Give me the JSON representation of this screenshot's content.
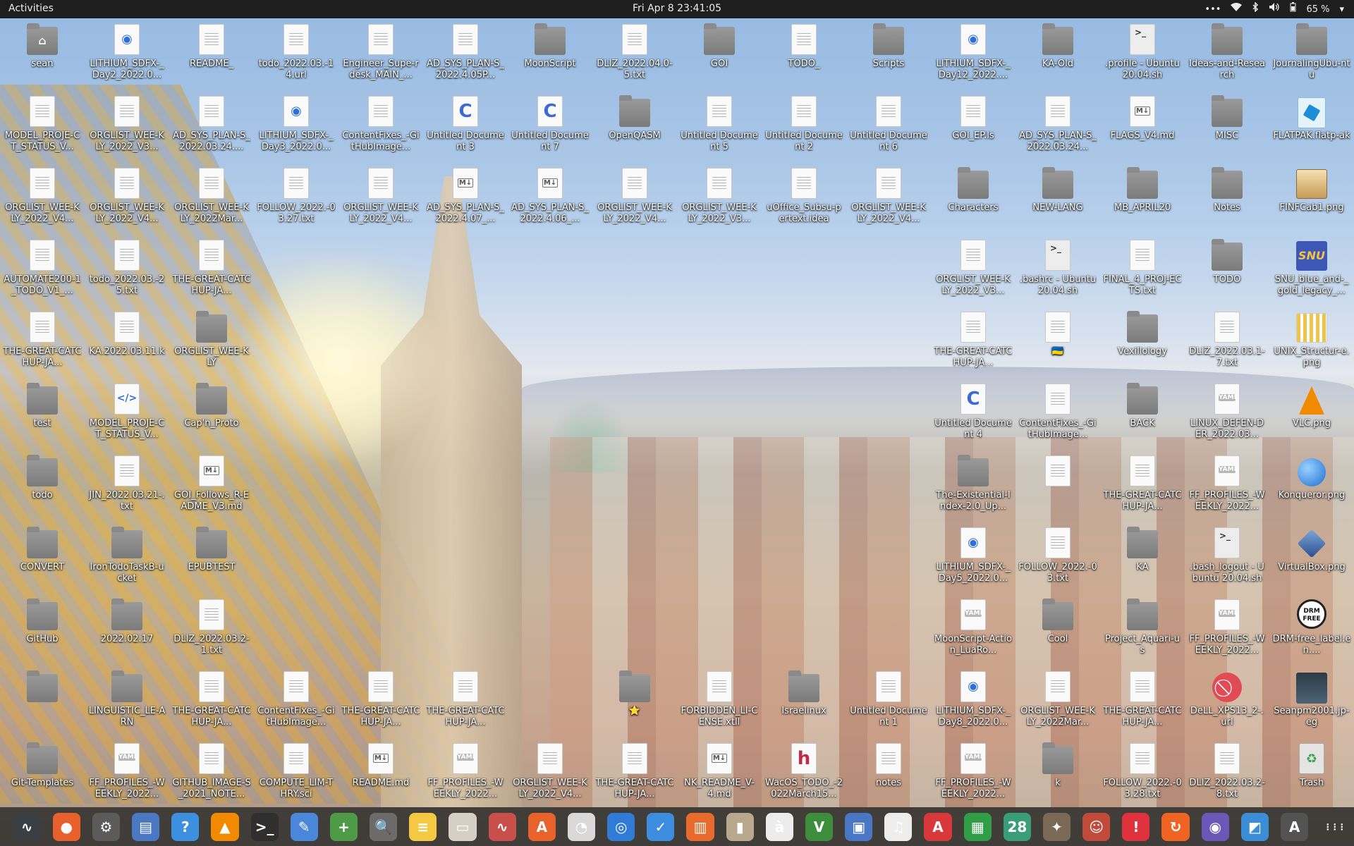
{
  "topbar": {
    "activities": "Activities",
    "clock": "Fri Apr 8  23:41:05",
    "dots": "•••",
    "wifi": "wifi-icon",
    "bluetooth": "bluetooth-icon",
    "volume": "volume-icon",
    "battery": "65 %",
    "menu": "▾"
  },
  "icons": [
    {
      "row": 0,
      "col": 0,
      "label": "sean",
      "kind": "home"
    },
    {
      "row": 0,
      "col": 1,
      "label": "LITHIUM_SDFX-_Day2_2022.0...",
      "kind": "url"
    },
    {
      "row": 0,
      "col": 2,
      "label": "README_",
      "kind": "doc"
    },
    {
      "row": 0,
      "col": 3,
      "label": "todo_2022.03.-14.url",
      "kind": "doc"
    },
    {
      "row": 0,
      "col": 4,
      "label": "Engineer_Supe-rdesk_MAIN_...",
      "kind": "doc"
    },
    {
      "row": 0,
      "col": 5,
      "label": "AD_SYS_PLAN-S_2022.4.05P...",
      "kind": "doc"
    },
    {
      "row": 0,
      "col": 6,
      "label": "MoonScript",
      "kind": "folder"
    },
    {
      "row": 0,
      "col": 7,
      "label": "DLIZ_2022.04.0-5.txt",
      "kind": "doc"
    },
    {
      "row": 0,
      "col": 8,
      "label": "GOI",
      "kind": "folder"
    },
    {
      "row": 0,
      "col": 9,
      "label": "TODO_",
      "kind": "doc"
    },
    {
      "row": 0,
      "col": 10,
      "label": "Scripts",
      "kind": "folder"
    },
    {
      "row": 0,
      "col": 11,
      "label": "LITHIUM_SDFX-_Day12_2022....",
      "kind": "url"
    },
    {
      "row": 0,
      "col": 12,
      "label": "KA-Old",
      "kind": "folder"
    },
    {
      "row": 0,
      "col": 13,
      "label": ".profile - Ubuntu 20.04.sh",
      "kind": "sh"
    },
    {
      "row": 0,
      "col": 14,
      "label": "Ideas-and-Research",
      "kind": "folder"
    },
    {
      "row": 0,
      "col": 15,
      "label": "JournalingUbu-ntu",
      "kind": "folder"
    },
    {
      "row": 1,
      "col": 0,
      "label": "MODEL_PROJE-CT_STATUS_V...",
      "kind": "doc"
    },
    {
      "row": 1,
      "col": 1,
      "label": "ORGLIST_WEE-KLY_2022_V3...",
      "kind": "doc"
    },
    {
      "row": 1,
      "col": 2,
      "label": "AD_SYS_PLAN-S_2022.03.24....",
      "kind": "doc"
    },
    {
      "row": 1,
      "col": 3,
      "label": "LITHIUM_SDFX-_Day3_2022.0...",
      "kind": "url"
    },
    {
      "row": 1,
      "col": 4,
      "label": "ContentFixes_-GitHubImage...",
      "kind": "doc"
    },
    {
      "row": 1,
      "col": 5,
      "label": "Untitled Document 3",
      "kind": "c"
    },
    {
      "row": 1,
      "col": 6,
      "label": "Untitled Document 7",
      "kind": "c"
    },
    {
      "row": 1,
      "col": 7,
      "label": "OpenQASM",
      "kind": "folder"
    },
    {
      "row": 1,
      "col": 8,
      "label": "Untitled Document 5",
      "kind": "doc"
    },
    {
      "row": 1,
      "col": 9,
      "label": "Untitled Document 2",
      "kind": "doc"
    },
    {
      "row": 1,
      "col": 10,
      "label": "Untitled Document 6",
      "kind": "doc"
    },
    {
      "row": 1,
      "col": 11,
      "label": "GOI_EP.ls",
      "kind": "doc"
    },
    {
      "row": 1,
      "col": 12,
      "label": "AD_SYS_PLAN-S_2022.03.24...",
      "kind": "doc"
    },
    {
      "row": 1,
      "col": 13,
      "label": "FLAGS_V4.md",
      "kind": "md"
    },
    {
      "row": 1,
      "col": 14,
      "label": "MISC",
      "kind": "folder"
    },
    {
      "row": 1,
      "col": 15,
      "label": "FLATPAK.flatp-ak",
      "kind": "blue"
    },
    {
      "row": 2,
      "col": 0,
      "label": "ORGLIST_WEE-KLY_2022_V4...",
      "kind": "doc"
    },
    {
      "row": 2,
      "col": 1,
      "label": "ORGLIST_WEE-KLY_2022_V4...",
      "kind": "doc"
    },
    {
      "row": 2,
      "col": 2,
      "label": "ORGLIST_WEE-KLY_2022Mar...",
      "kind": "doc"
    },
    {
      "row": 2,
      "col": 3,
      "label": "FOLLOW_2022.-03.27.txt",
      "kind": "doc"
    },
    {
      "row": 2,
      "col": 4,
      "label": "ORGLIST_WEE-KLY_2022_V4...",
      "kind": "doc"
    },
    {
      "row": 2,
      "col": 5,
      "label": "AD_SYS_PLAN-S_2022.4.07_...",
      "kind": "md"
    },
    {
      "row": 2,
      "col": 6,
      "label": "AD_SYS_PLAN-S_2022.4.06_...",
      "kind": "md"
    },
    {
      "row": 2,
      "col": 7,
      "label": "ORGLIST_WEE-KLY_2022_V4...",
      "kind": "doc"
    },
    {
      "row": 2,
      "col": 8,
      "label": "ORGLIST_WEE-KLY_2022_V3...",
      "kind": "doc"
    },
    {
      "row": 2,
      "col": 9,
      "label": "uOffice_Subsu-pertext.idea",
      "kind": "doc"
    },
    {
      "row": 2,
      "col": 10,
      "label": "ORGLIST_WEE-KLY_2022_V4...",
      "kind": "doc"
    },
    {
      "row": 2,
      "col": 11,
      "label": "Characters",
      "kind": "folder"
    },
    {
      "row": 2,
      "col": 12,
      "label": "NEW-LANG",
      "kind": "folder"
    },
    {
      "row": 2,
      "col": 13,
      "label": "MB_APRIL20",
      "kind": "folder"
    },
    {
      "row": 2,
      "col": 14,
      "label": "Notes",
      "kind": "folder"
    },
    {
      "row": 2,
      "col": 15,
      "label": "FINFCab1.png",
      "kind": "cab"
    },
    {
      "row": 3,
      "col": 0,
      "label": "AUTOMATE200-1_TODO_V1_...",
      "kind": "doc"
    },
    {
      "row": 3,
      "col": 1,
      "label": "todo_2022.03.-25.txt",
      "kind": "doc"
    },
    {
      "row": 3,
      "col": 2,
      "label": "THE-GREAT-CATCHUP-JA...",
      "kind": "doc"
    },
    {
      "row": 3,
      "col": 11,
      "label": "ORGLIST_WEE-KLY_2022_V3...",
      "kind": "doc"
    },
    {
      "row": 3,
      "col": 12,
      "label": ".bashrc - Ubuntu 20.04.sh",
      "kind": "sh"
    },
    {
      "row": 3,
      "col": 13,
      "label": "FINAL_4_PROJ-ECTS.txt",
      "kind": "doc"
    },
    {
      "row": 3,
      "col": 14,
      "label": "TODO",
      "kind": "folder"
    },
    {
      "row": 3,
      "col": 15,
      "label": "SNU_blue_and-_gold_legacy_...",
      "kind": "snu"
    },
    {
      "row": 4,
      "col": 0,
      "label": "THE-GREAT-CATCHUP-JA...",
      "kind": "doc"
    },
    {
      "row": 4,
      "col": 1,
      "label": "KA.2022.03.11.k",
      "kind": "doc"
    },
    {
      "row": 4,
      "col": 2,
      "label": "ORGLIST_WEE-KLY",
      "kind": "folder"
    },
    {
      "row": 4,
      "col": 11,
      "label": "THE-GREAT-CATCHUP-JA...",
      "kind": "doc"
    },
    {
      "row": 4,
      "col": 12,
      "label": "🇺🇦",
      "kind": "doc"
    },
    {
      "row": 4,
      "col": 13,
      "label": "Vexillology",
      "kind": "folder"
    },
    {
      "row": 4,
      "col": 14,
      "label": "DLIZ_2022.03.1-7.txt",
      "kind": "doc"
    },
    {
      "row": 4,
      "col": 15,
      "label": "UNIX_Structur-e.png",
      "kind": "unix"
    },
    {
      "row": 5,
      "col": 0,
      "label": "test",
      "kind": "folder"
    },
    {
      "row": 5,
      "col": 1,
      "label": "MODEL_PROJE-CT_STATUS_V...",
      "kind": "html"
    },
    {
      "row": 5,
      "col": 2,
      "label": "Cap'n_Proto",
      "kind": "folder"
    },
    {
      "row": 5,
      "col": 11,
      "label": "Untitled Document 4",
      "kind": "c"
    },
    {
      "row": 5,
      "col": 12,
      "label": "ContentFixes_-GitHubImage...",
      "kind": "doc"
    },
    {
      "row": 5,
      "col": 13,
      "label": "BACK",
      "kind": "folder"
    },
    {
      "row": 5,
      "col": 14,
      "label": "LINUX_DEFEN-DER_2022.03...",
      "kind": "yaml"
    },
    {
      "row": 5,
      "col": 15,
      "label": "VLC.png",
      "kind": "vlc"
    },
    {
      "row": 6,
      "col": 0,
      "label": "todo",
      "kind": "folder"
    },
    {
      "row": 6,
      "col": 1,
      "label": "JIN_2022.03.21-.txt",
      "kind": "doc"
    },
    {
      "row": 6,
      "col": 2,
      "label": "GOI_Follows_R-EADME_V3.md",
      "kind": "md"
    },
    {
      "row": 6,
      "col": 11,
      "label": "The-Existential-Index-2.0_Up...",
      "kind": "folder"
    },
    {
      "row": 6,
      "col": 12,
      "label": "",
      "kind": "doc"
    },
    {
      "row": 6,
      "col": 13,
      "label": "THE-GREAT-CATCHUP-JA...",
      "kind": "doc"
    },
    {
      "row": 6,
      "col": 14,
      "label": "FF_PROFILES_-WEEKLY_2022...",
      "kind": "yaml"
    },
    {
      "row": 6,
      "col": 15,
      "label": "Konqueror.png",
      "kind": "konq"
    },
    {
      "row": 7,
      "col": 0,
      "label": "CONVERT",
      "kind": "folder"
    },
    {
      "row": 7,
      "col": 1,
      "label": "IronTodoTaskB-ucket",
      "kind": "folder"
    },
    {
      "row": 7,
      "col": 2,
      "label": "EPUBTEST",
      "kind": "folder"
    },
    {
      "row": 7,
      "col": 11,
      "label": "LITHIUM_SDFX-_Day5_2022.0...",
      "kind": "url"
    },
    {
      "row": 7,
      "col": 12,
      "label": "FOLLOW_2022.-03.txt",
      "kind": "doc"
    },
    {
      "row": 7,
      "col": 13,
      "label": "KA",
      "kind": "folder"
    },
    {
      "row": 7,
      "col": 14,
      "label": ".bash_logout - Ubuntu 20.04.sh",
      "kind": "sh"
    },
    {
      "row": 7,
      "col": 15,
      "label": "VirtualBox.png",
      "kind": "vbox"
    },
    {
      "row": 8,
      "col": 0,
      "label": "GitHub",
      "kind": "folder"
    },
    {
      "row": 8,
      "col": 1,
      "label": "2022.02.17",
      "kind": "folder"
    },
    {
      "row": 8,
      "col": 2,
      "label": "DLIZ_2022.03.2-1.txt",
      "kind": "doc"
    },
    {
      "row": 8,
      "col": 11,
      "label": "MoonScript-Action_LuaRo...",
      "kind": "yaml"
    },
    {
      "row": 8,
      "col": 12,
      "label": "Cool",
      "kind": "folder"
    },
    {
      "row": 8,
      "col": 13,
      "label": "Project_Aquari-us",
      "kind": "folder"
    },
    {
      "row": 8,
      "col": 14,
      "label": "FF_PROFILES_-WEEKLY_2022...",
      "kind": "yaml"
    },
    {
      "row": 8,
      "col": 15,
      "label": "DRM-free_label.en....",
      "kind": "drm"
    },
    {
      "row": 9,
      "col": 0,
      "label": "",
      "kind": "folder"
    },
    {
      "row": 9,
      "col": 1,
      "label": "LINGUISTIC_LE-ARN",
      "kind": "folder"
    },
    {
      "row": 9,
      "col": 2,
      "label": "THE-GREAT-CATCHUP-JA...",
      "kind": "doc"
    },
    {
      "row": 9,
      "col": 3,
      "label": "ContentFixes_-GitHubImage...",
      "kind": "doc"
    },
    {
      "row": 9,
      "col": 4,
      "label": "THE-GREAT-CATCHUP-JA...",
      "kind": "doc"
    },
    {
      "row": 9,
      "col": 5,
      "label": "THE-GREAT-CATCHUP-JA...",
      "kind": "doc"
    },
    {
      "row": 9,
      "col": 7,
      "label": "⭐",
      "kind": "folder"
    },
    {
      "row": 9,
      "col": 8,
      "label": "FORBIDDEN_LI-CENSE.xtll",
      "kind": "doc"
    },
    {
      "row": 9,
      "col": 9,
      "label": "Israelinux",
      "kind": "folder"
    },
    {
      "row": 9,
      "col": 10,
      "label": "Untitled Document 1",
      "kind": "doc"
    },
    {
      "row": 9,
      "col": 11,
      "label": "LITHIUM_SDFX-_Day8_2022.0...",
      "kind": "url"
    },
    {
      "row": 9,
      "col": 12,
      "label": "ORGLIST_WEE-KLY_2022Mar...",
      "kind": "doc"
    },
    {
      "row": 9,
      "col": 13,
      "label": "THE-GREAT-CATCHUP-JA...",
      "kind": "doc"
    },
    {
      "row": 9,
      "col": 14,
      "label": "DeLL_XPS13_2-.url",
      "kind": "forbid"
    },
    {
      "row": 9,
      "col": 15,
      "label": "Seanpm2001.jp-eg",
      "kind": "photo"
    },
    {
      "row": 10,
      "col": 0,
      "label": "Git-Templates",
      "kind": "folder"
    },
    {
      "row": 10,
      "col": 1,
      "label": "FF_PROFILES_-WEEKLY_2022...",
      "kind": "yaml"
    },
    {
      "row": 10,
      "col": 2,
      "label": "GITHUB_IMAGE-S_2021_NOTE...",
      "kind": "doc"
    },
    {
      "row": 10,
      "col": 3,
      "label": "COMPUTE_LIM-THRY.sci",
      "kind": "doc"
    },
    {
      "row": 10,
      "col": 4,
      "label": "README.md",
      "kind": "md"
    },
    {
      "row": 10,
      "col": 5,
      "label": "FF_PROFILES_-WEEKLY_2022...",
      "kind": "yaml"
    },
    {
      "row": 10,
      "col": 6,
      "label": "ORGLIST_WEE-KLY_2022_V4...",
      "kind": "doc"
    },
    {
      "row": 10,
      "col": 7,
      "label": "THE-GREAT-CATCHUP-JA...",
      "kind": "doc"
    },
    {
      "row": 10,
      "col": 8,
      "label": "NK_README_V-4.md",
      "kind": "md"
    },
    {
      "row": 10,
      "col": 9,
      "label": "WacOS_TODO_-2022March15...",
      "kind": "h"
    },
    {
      "row": 10,
      "col": 10,
      "label": "notes",
      "kind": "doc"
    },
    {
      "row": 10,
      "col": 11,
      "label": "FF_PROFILES_-WEEKLY_2022...",
      "kind": "yaml"
    },
    {
      "row": 10,
      "col": 12,
      "label": "k",
      "kind": "folder"
    },
    {
      "row": 10,
      "col": 13,
      "label": "FOLLOW_2022.-03.28.txt",
      "kind": "doc"
    },
    {
      "row": 10,
      "col": 14,
      "label": "DLIZ_2022.03.2-8.txt",
      "kind": "doc"
    },
    {
      "row": 10,
      "col": 15,
      "label": "Trash",
      "kind": "trash"
    }
  ],
  "dock": [
    {
      "name": "system-monitor-icon",
      "glyph": "∿",
      "color": "#3a3f44"
    },
    {
      "name": "firefox-icon",
      "glyph": "●",
      "color": "#e8602c"
    },
    {
      "name": "settings-icon",
      "glyph": "⚙",
      "color": "#5b5b5b"
    },
    {
      "name": "document-viewer-icon",
      "glyph": "▤",
      "color": "#4a78c2"
    },
    {
      "name": "help-icon",
      "glyph": "?",
      "color": "#3d8fe0"
    },
    {
      "name": "vlc-icon",
      "glyph": "▲",
      "color": "#f28a00"
    },
    {
      "name": "terminal-icon",
      "glyph": ">_",
      "color": "#2f2f2f"
    },
    {
      "name": "text-editor-icon",
      "glyph": "✎",
      "color": "#4a86d9"
    },
    {
      "name": "calculator-icon",
      "glyph": "+",
      "color": "#4e9a47"
    },
    {
      "name": "image-viewer-icon",
      "glyph": "🔍",
      "color": "#6b6b6b"
    },
    {
      "name": "notes-icon",
      "glyph": "≡",
      "color": "#f4c842"
    },
    {
      "name": "files-icon",
      "glyph": "▭",
      "color": "#d6d0c4"
    },
    {
      "name": "gnuplot-icon",
      "glyph": "∿",
      "color": "#c9504a"
    },
    {
      "name": "software-center-icon",
      "glyph": "A",
      "color": "#e9622c"
    },
    {
      "name": "disk-usage-icon",
      "glyph": "◔",
      "color": "#d9d9d9"
    },
    {
      "name": "color-picker-icon",
      "glyph": "◎",
      "color": "#2f7bd6"
    },
    {
      "name": "todo-icon",
      "glyph": "✓",
      "color": "#3c8de0"
    },
    {
      "name": "document-scanner-icon",
      "glyph": "▥",
      "color": "#e86a2c"
    },
    {
      "name": "archive-manager-icon",
      "glyph": "▮",
      "color": "#b9a98c"
    },
    {
      "name": "character-map-icon",
      "glyph": "à",
      "color": "#ececec"
    },
    {
      "name": "vim-icon",
      "glyph": "V",
      "color": "#3c8d3c"
    },
    {
      "name": "remote-desktop-icon",
      "glyph": "▣",
      "color": "#4a76c6"
    },
    {
      "name": "music-icon",
      "glyph": "♫",
      "color": "#ededed"
    },
    {
      "name": "pdf-viewer-icon",
      "glyph": "A",
      "color": "#d9383a"
    },
    {
      "name": "spreadsheet-icon",
      "glyph": "▦",
      "color": "#2f9e46"
    },
    {
      "name": "calendar-icon",
      "glyph": "28",
      "color": "#3a9d7a"
    },
    {
      "name": "gimp-icon",
      "glyph": "✦",
      "color": "#7a6a55"
    },
    {
      "name": "game-icon",
      "glyph": "☺",
      "color": "#c24a3a"
    },
    {
      "name": "alert-icon",
      "glyph": "!",
      "color": "#e0323c"
    },
    {
      "name": "update-icon",
      "glyph": "↻",
      "color": "#f06423"
    },
    {
      "name": "screenshot-icon",
      "glyph": "◉",
      "color": "#6a58b8"
    },
    {
      "name": "photo-editor-icon",
      "glyph": "◩",
      "color": "#3b8ed6"
    },
    {
      "name": "mail-icon",
      "glyph": "A",
      "color": "#535353"
    },
    {
      "name": "show-apps-icon",
      "glyph": "⋮⋮⋮",
      "color": "transparent"
    }
  ]
}
